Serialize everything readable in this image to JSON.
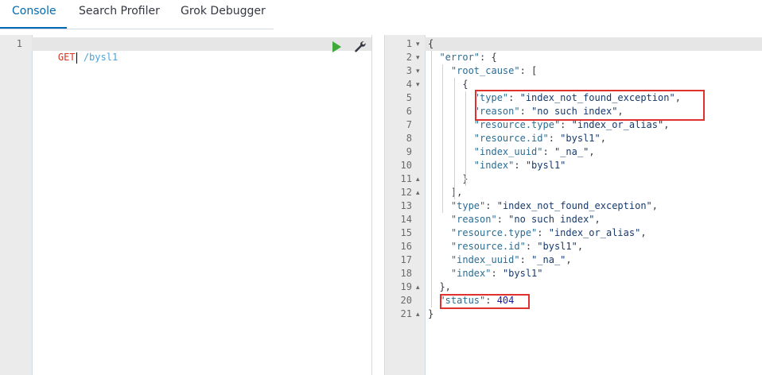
{
  "tabs": [
    {
      "label": "Console",
      "active": true
    },
    {
      "label": "Search Profiler",
      "active": false
    },
    {
      "label": "Grok Debugger",
      "active": false
    }
  ],
  "request": {
    "line_number": "1",
    "method": "GET",
    "path": "/bysl1"
  },
  "response": {
    "lines": [
      {
        "n": "1",
        "fold": "▾",
        "text": "{"
      },
      {
        "n": "2",
        "fold": "▾",
        "text": "  \"error\": {"
      },
      {
        "n": "3",
        "fold": "▾",
        "text": "    \"root_cause\": ["
      },
      {
        "n": "4",
        "fold": "▾",
        "text": "      {"
      },
      {
        "n": "5",
        "fold": "",
        "text": "        \"type\": \"index_not_found_exception\","
      },
      {
        "n": "6",
        "fold": "",
        "text": "        \"reason\": \"no such index\","
      },
      {
        "n": "7",
        "fold": "",
        "text": "        \"resource.type\": \"index_or_alias\","
      },
      {
        "n": "8",
        "fold": "",
        "text": "        \"resource.id\": \"bysl1\","
      },
      {
        "n": "9",
        "fold": "",
        "text": "        \"index_uuid\": \"_na_\","
      },
      {
        "n": "10",
        "fold": "",
        "text": "        \"index\": \"bysl1\""
      },
      {
        "n": "11",
        "fold": "▴",
        "text": "      }"
      },
      {
        "n": "12",
        "fold": "▴",
        "text": "    ],"
      },
      {
        "n": "13",
        "fold": "",
        "text": "    \"type\": \"index_not_found_exception\","
      },
      {
        "n": "14",
        "fold": "",
        "text": "    \"reason\": \"no such index\","
      },
      {
        "n": "15",
        "fold": "",
        "text": "    \"resource.type\": \"index_or_alias\","
      },
      {
        "n": "16",
        "fold": "",
        "text": "    \"resource.id\": \"bysl1\","
      },
      {
        "n": "17",
        "fold": "",
        "text": "    \"index_uuid\": \"_na_\","
      },
      {
        "n": "18",
        "fold": "",
        "text": "    \"index\": \"bysl1\""
      },
      {
        "n": "19",
        "fold": "▴",
        "text": "  },"
      },
      {
        "n": "20",
        "fold": "",
        "text": "  \"status\": 404"
      },
      {
        "n": "21",
        "fold": "▴",
        "text": "}"
      }
    ]
  },
  "colors": {
    "accent": "#006bb4",
    "highlight_box": "#e0312f",
    "run": "#3daa3a"
  },
  "icons": {
    "run": "play-icon",
    "settings": "wrench-icon"
  }
}
